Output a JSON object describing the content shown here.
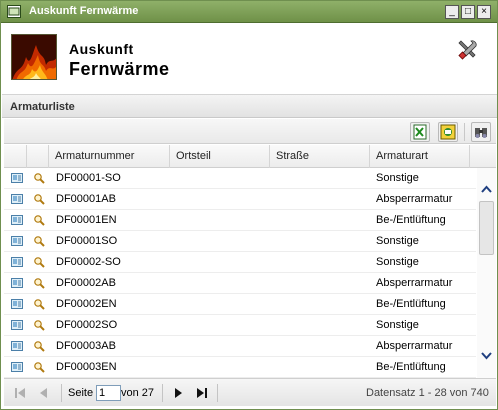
{
  "window": {
    "title": "Auskunft Fernwärme",
    "controls": [
      "_",
      "□",
      "×"
    ]
  },
  "header": {
    "line1": "Auskunft",
    "line2": "Fernwärme"
  },
  "section": {
    "title": "Armaturliste"
  },
  "toolbar": {
    "buttons": [
      "excel-export-icon",
      "document-export-icon",
      "binoculars-icon"
    ]
  },
  "grid": {
    "columns": [
      "Armaturnummer",
      "Ortsteil",
      "Straße",
      "Armaturart"
    ],
    "rows": [
      {
        "nr": "DF00001-SO",
        "ortsteil": "",
        "strasse": "",
        "art": "Sonstige"
      },
      {
        "nr": "DF00001AB",
        "ortsteil": "",
        "strasse": "",
        "art": "Absperrarmatur"
      },
      {
        "nr": "DF00001EN",
        "ortsteil": "",
        "strasse": "",
        "art": "Be-/Entlüftung"
      },
      {
        "nr": "DF00001SO",
        "ortsteil": "",
        "strasse": "",
        "art": "Sonstige"
      },
      {
        "nr": "DF00002-SO",
        "ortsteil": "",
        "strasse": "",
        "art": "Sonstige"
      },
      {
        "nr": "DF00002AB",
        "ortsteil": "",
        "strasse": "",
        "art": "Absperrarmatur"
      },
      {
        "nr": "DF00002EN",
        "ortsteil": "",
        "strasse": "",
        "art": "Be-/Entlüftung"
      },
      {
        "nr": "DF00002SO",
        "ortsteil": "",
        "strasse": "",
        "art": "Sonstige"
      },
      {
        "nr": "DF00003AB",
        "ortsteil": "",
        "strasse": "",
        "art": "Absperrarmatur"
      },
      {
        "nr": "DF00003EN",
        "ortsteil": "",
        "strasse": "",
        "art": "Be-/Entlüftung"
      }
    ]
  },
  "pager": {
    "page_label": "Seite",
    "page_value": "1",
    "of_label": "von 27",
    "record_info": "Datensatz 1 - 28 von 740"
  },
  "colors": {
    "titlebar": "#7a9c55",
    "header_bg": "#ffffff",
    "grid_border": "#d5d5d5"
  }
}
